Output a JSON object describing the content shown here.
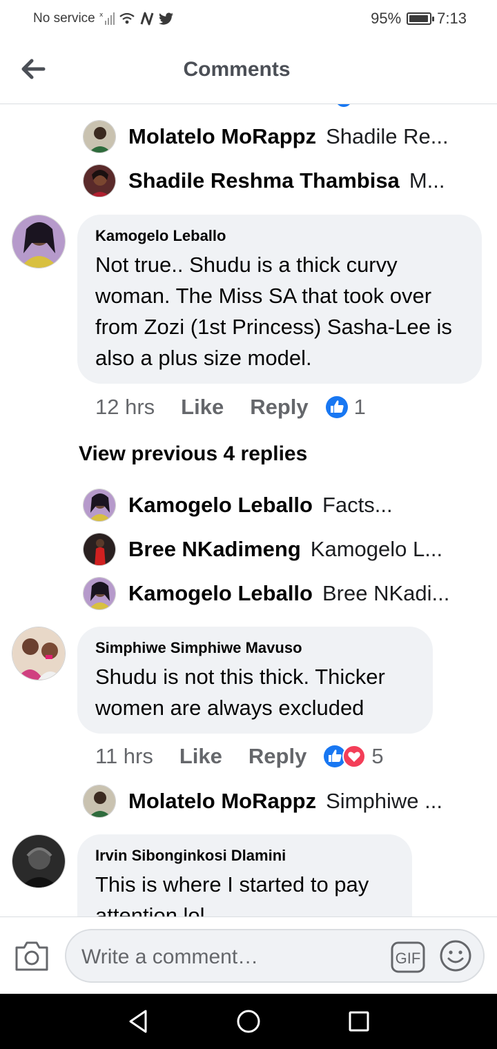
{
  "status_bar": {
    "carrier": "No service",
    "battery": "95%",
    "battery_level": 0.95,
    "time": "7:13"
  },
  "header": {
    "title": "Comments"
  },
  "replies_top": [
    {
      "name": "Molatelo MoRappz",
      "preview": "Shadile Re..."
    },
    {
      "name": "Shadile Reshma Thambisa",
      "preview": "M..."
    }
  ],
  "comments": [
    {
      "name": "Kamogelo Leballo",
      "text": "Not true.. Shudu is a thick curvy woman. The Miss SA that took over from Zozi (1st Princess) Sasha-Lee is also a plus size model.",
      "time": "12 hrs",
      "like": "Like",
      "reply": "Reply",
      "reaction_count": "1",
      "view_previous": "View previous 4 replies",
      "replies": [
        {
          "name": "Kamogelo Leballo",
          "preview": "Facts..."
        },
        {
          "name": "Bree NKadimeng",
          "preview": "Kamogelo L..."
        },
        {
          "name": "Kamogelo Leballo",
          "preview": "Bree NKadi..."
        }
      ]
    },
    {
      "name": "Simphiwe Simphiwe Mavuso",
      "text": "Shudu is not this thick. Thicker women are always excluded",
      "time": "11 hrs",
      "like": "Like",
      "reply": "Reply",
      "reaction_count": "5",
      "replies": [
        {
          "name": "Molatelo MoRappz",
          "preview": "Simphiwe ..."
        }
      ]
    },
    {
      "name": "Irvin Sibonginkosi Dlamini",
      "text": "This is where I started to pay attention lol"
    }
  ],
  "composer": {
    "placeholder": "Write a comment…",
    "gif_label": "GIF"
  },
  "icons": {
    "back": "arrow-left-icon",
    "like_reaction": "thumbs-up-icon",
    "love_reaction": "heart-icon",
    "camera": "camera-icon",
    "emoji": "smiley-icon",
    "nav_back": "triangle-back-icon",
    "nav_home": "circle-home-icon",
    "nav_recents": "square-recents-icon"
  },
  "colors": {
    "like_blue": "#1877f2",
    "love_red": "#f33e58",
    "bubble_bg": "#f0f2f5",
    "meta_gray": "#65676b"
  }
}
